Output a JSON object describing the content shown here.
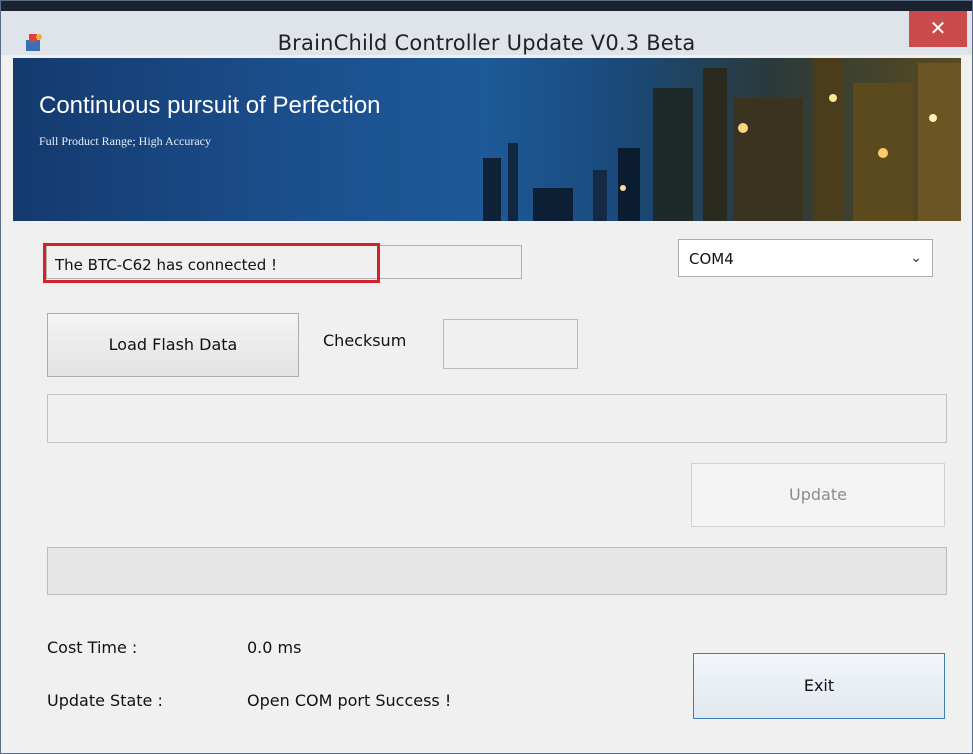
{
  "window": {
    "title": "BrainChild Controller Update V0.3 Beta",
    "close_glyph": "✕"
  },
  "banner": {
    "title": "Continuous pursuit of Perfection",
    "subtitle": "Full Product Range; High Accuracy"
  },
  "status": {
    "message": "The BTC-C62 has connected !"
  },
  "com_port": {
    "selected": "COM4"
  },
  "buttons": {
    "load": "Load Flash Data",
    "update": "Update",
    "exit": "Exit"
  },
  "checksum": {
    "label": "Checksum",
    "value": ""
  },
  "file_path": {
    "value": ""
  },
  "progress": {
    "percent": 0
  },
  "info": {
    "cost_time_label": "Cost Time :",
    "cost_time_value": "0.0 ms",
    "update_state_label": "Update State :",
    "update_state_value": "Open COM port Success !"
  },
  "colors": {
    "highlight": "#d6202a",
    "close_button": "#c94b4b",
    "banner": "#1b4f8d"
  }
}
